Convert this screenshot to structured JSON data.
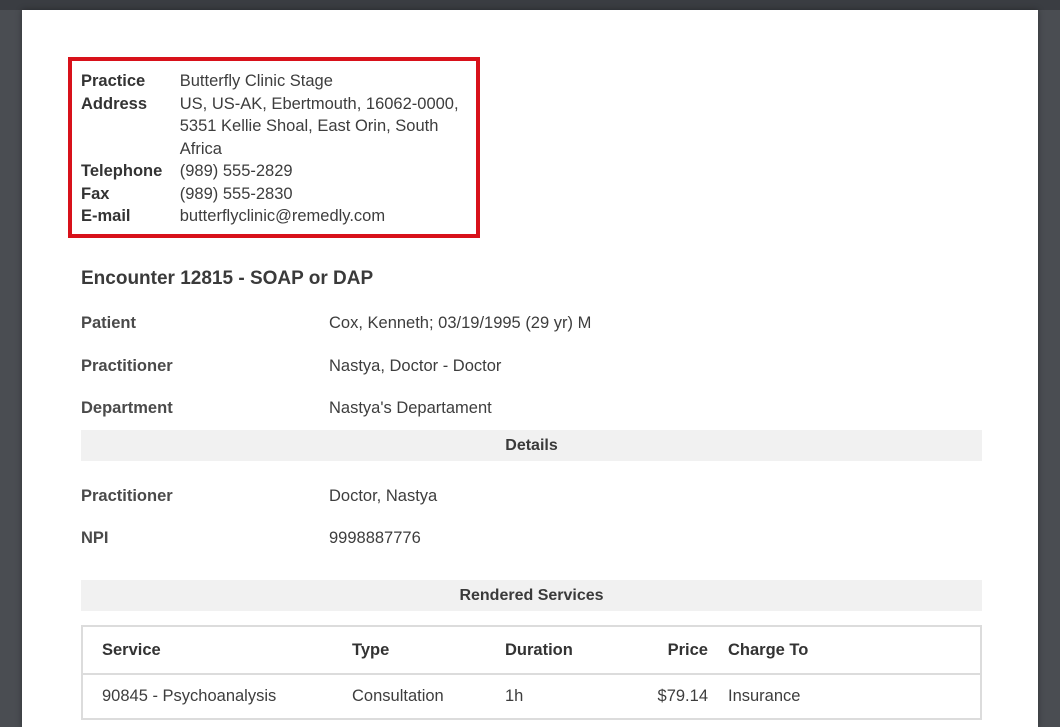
{
  "practice": {
    "rows": [
      {
        "label": "Practice",
        "value": "Butterfly Clinic Stage"
      },
      {
        "label": "Address",
        "value": "US, US-AK, Ebertmouth, 16062-0000, 5351 Kellie Shoal, East Orin, South Africa"
      },
      {
        "label": "Telephone",
        "value": "(989) 555-2829"
      },
      {
        "label": "Fax",
        "value": "(989) 555-2830"
      },
      {
        "label": "E-mail",
        "value": "butterflyclinic@remedly.com"
      }
    ]
  },
  "encounter": {
    "title": "Encounter 12815 - SOAP or DAP",
    "patient_label": "Patient",
    "patient_value": "Cox, Kenneth; 03/19/1995 (29 yr) M",
    "practitioner_label": "Practitioner",
    "practitioner_value": "Nastya, Doctor - Doctor",
    "department_label": "Department",
    "department_value": "Nastya's Departament"
  },
  "details": {
    "heading": "Details",
    "practitioner_label": "Practitioner",
    "practitioner_value": "Doctor, Nastya",
    "npi_label": "NPI",
    "npi_value": "9998887776"
  },
  "services": {
    "heading": "Rendered Services",
    "columns": [
      "Service",
      "Type",
      "Duration",
      "Price",
      "Charge To"
    ],
    "rows": [
      [
        "90845 - Psychoanalysis",
        "Consultation",
        "1h",
        "$79.14",
        "Insurance"
      ]
    ]
  },
  "colors": {
    "highlight_border": "#d8111a",
    "section_bar": "#f1f1f1",
    "backdrop": "#4a4d52"
  }
}
